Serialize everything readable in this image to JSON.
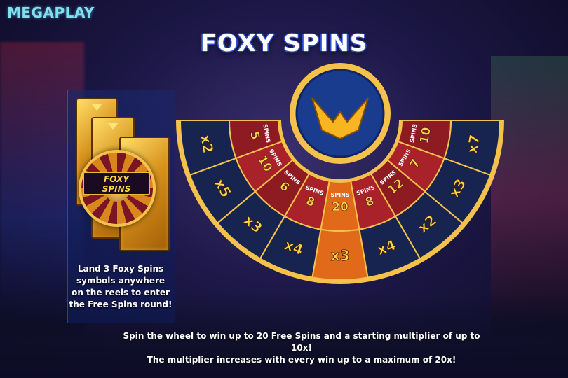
{
  "brand": {
    "logo_text": "MEGAPLAY"
  },
  "title": "FOXY SPINS",
  "info_panel": {
    "badge_line1": "FOXY",
    "badge_line2": "SPINS",
    "lines": [
      "Land 3 Foxy Spins",
      "symbols anywhere",
      "on the reels to enter",
      "the Free Spins round!"
    ]
  },
  "wheel": {
    "outer_ring": [
      "x2",
      "x5",
      "x3",
      "x4",
      "x3",
      "x4",
      "x2",
      "x3",
      "x7"
    ],
    "inner_ring": [
      {
        "num": "5",
        "label": "SPINS"
      },
      {
        "num": "10",
        "label": "SPINS"
      },
      {
        "num": "6",
        "label": "SPINS"
      },
      {
        "num": "8",
        "label": "SPINS"
      },
      {
        "num": "20",
        "label": "SPINS"
      },
      {
        "num": "8",
        "label": "SPINS"
      },
      {
        "num": "12",
        "label": "SPINS"
      },
      {
        "num": "7",
        "label": "SPINS"
      },
      {
        "num": "10",
        "label": "SPINS"
      }
    ],
    "colors": {
      "outer_dark": "#16244f",
      "inner_red": "#8e1a22",
      "inner_red_alt": "#a92229",
      "gold": "#f4c24a",
      "text_gold": "#ffd447",
      "center_blue": "#1a3c8f",
      "pointer_orange": "#e06a1a"
    }
  },
  "footer": {
    "line1": "Spin the wheel to win up to 20 Free Spins and a starting multiplier of up to 10x!",
    "line2": "The multiplier increases with every win up to a maximum of 20x!"
  }
}
